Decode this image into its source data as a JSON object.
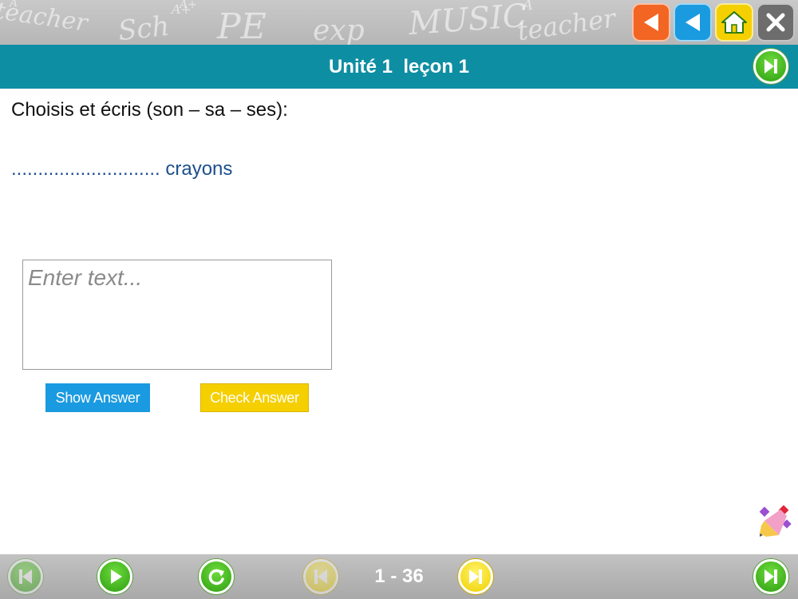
{
  "banner": {
    "chalk_words": [
      "teacher",
      "Sch",
      "A+",
      "PE",
      "exp",
      "MUSIC",
      "A",
      "teacher",
      "A+",
      "A"
    ],
    "buttons": [
      {
        "name": "back-orange",
        "icon": "triangle-left-icon",
        "color": "#f26522"
      },
      {
        "name": "back-blue",
        "icon": "triangle-left-icon",
        "color": "#1a9be0"
      },
      {
        "name": "home",
        "icon": "home-icon",
        "color": "#f5d000"
      },
      {
        "name": "close",
        "icon": "close-icon",
        "color": "#6d6d6d"
      }
    ]
  },
  "header": {
    "title": "Unité 1  leçon 1",
    "background": "#0e8ea3"
  },
  "exercise": {
    "instruction": "Choisis et écris (son – sa – ses):",
    "question": "............................ crayons",
    "answer": {
      "value": "",
      "placeholder": "Enter text..."
    },
    "show_answer_label": "Show Answer",
    "check_answer_label": "Check Answer"
  },
  "footer": {
    "page_counter": "1 - 36"
  },
  "colors": {
    "teal": "#0e8ea3",
    "green": "#3fbf1c",
    "blue": "#1a9ae0",
    "yellow": "#f5cf00",
    "question_text": "#1d4f8c"
  }
}
